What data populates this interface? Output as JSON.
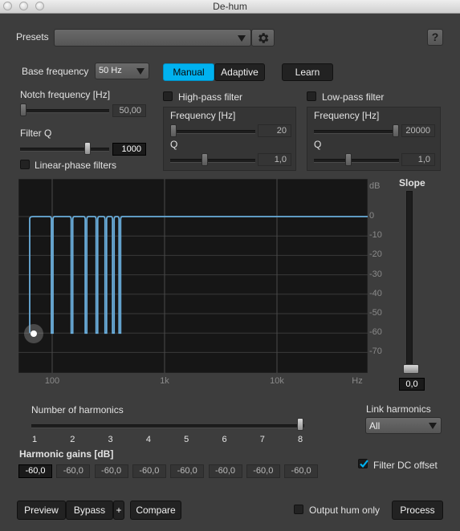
{
  "window": {
    "title": "De-hum"
  },
  "presets": {
    "label": "Presets",
    "value": "",
    "help": "?"
  },
  "base_frequency": {
    "label": "Base frequency",
    "value": "50 Hz"
  },
  "mode": {
    "manual": "Manual",
    "adaptive": "Adaptive",
    "learn": "Learn"
  },
  "notch": {
    "label": "Notch frequency [Hz]",
    "value": "50,00",
    "level": 0.0
  },
  "filter_q": {
    "label": "Filter Q",
    "value": "1000",
    "level": 0.78
  },
  "linear_phase": {
    "label": "Linear-phase filters",
    "checked": false
  },
  "highpass": {
    "label": "High-pass filter",
    "checked": false,
    "freq_label": "Frequency [Hz]",
    "freq_value": "20",
    "freq_level": 0.0,
    "q_label": "Q",
    "q_value": "1,0",
    "q_level": 0.4
  },
  "lowpass": {
    "label": "Low-pass filter",
    "checked": false,
    "freq_label": "Frequency [Hz]",
    "freq_value": "20000",
    "freq_level": 1.0,
    "q_label": "Q",
    "q_value": "1,0",
    "q_level": 0.4
  },
  "graph": {
    "db_label": "dB",
    "db_ticks": [
      "0",
      "-10",
      "-20",
      "-30",
      "-40",
      "-50",
      "-60",
      "-70"
    ],
    "freq_ticks": [
      "100",
      "1k",
      "10k",
      "Hz"
    ],
    "notch_freqs": [
      50,
      100,
      150,
      200,
      250,
      300,
      350,
      400
    ],
    "notch_depth_db": -60,
    "colors": {
      "curve": "#6aaedc",
      "grid": "#3a3a3a"
    }
  },
  "slope": {
    "label": "Slope",
    "value": "0,0",
    "level": 0.0
  },
  "harmonics": {
    "label": "Number of harmonics",
    "ticks": [
      "1",
      "2",
      "3",
      "4",
      "5",
      "6",
      "7",
      "8"
    ],
    "value": 8
  },
  "link": {
    "label": "Link harmonics",
    "value": "All"
  },
  "gains": {
    "label": "Harmonic gains [dB]",
    "values": [
      "-60,0",
      "-60,0",
      "-60,0",
      "-60,0",
      "-60,0",
      "-60,0",
      "-60,0",
      "-60,0"
    ]
  },
  "filter_dc": {
    "label": "Filter DC offset",
    "checked": true
  },
  "bottom": {
    "preview": "Preview",
    "bypass": "Bypass",
    "plus": "+",
    "compare": "Compare",
    "output_hum": "Output hum only",
    "process": "Process"
  },
  "accent": "#00b2f0"
}
